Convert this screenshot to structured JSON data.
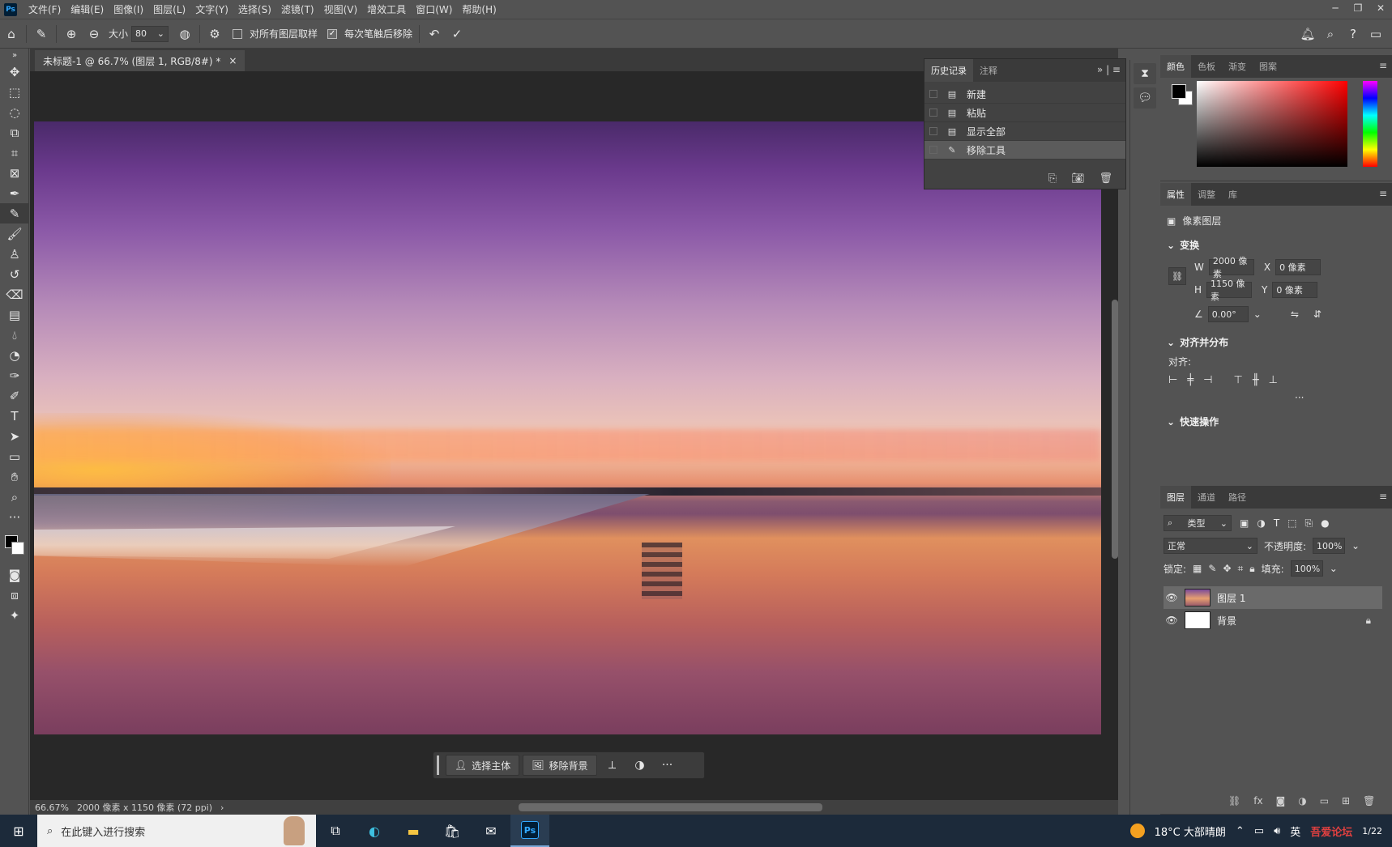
{
  "app": {
    "logo": "Ps"
  },
  "menu": [
    "文件(F)",
    "编辑(E)",
    "图像(I)",
    "图层(L)",
    "文字(Y)",
    "选择(S)",
    "滤镜(T)",
    "视图(V)",
    "增效工具",
    "窗口(W)",
    "帮助(H)"
  ],
  "window_controls": {
    "minimize": "─",
    "restore": "❐",
    "close": "✕"
  },
  "options": {
    "size_label": "大小",
    "size_value": "80",
    "sample_all_label": "对所有图层取样",
    "sample_all_checked": false,
    "remove_after_label": "每次笔触后移除",
    "remove_after_checked": true
  },
  "document": {
    "tab_title": "未标题-1 @ 66.7% (图层 1, RGB/8#) *",
    "close": "×"
  },
  "context_bar": {
    "select_subject": "选择主体",
    "remove_bg": "移除背景",
    "more": "···"
  },
  "history": {
    "tabs": [
      "历史记录",
      "注释"
    ],
    "items": [
      {
        "label": "新建",
        "icon": "document-icon"
      },
      {
        "label": "粘贴",
        "icon": "document-icon"
      },
      {
        "label": "显示全部",
        "icon": "document-icon"
      },
      {
        "label": "移除工具",
        "icon": "remove-tool-icon",
        "active": true
      }
    ]
  },
  "color_panel": {
    "tabs": [
      "颜色",
      "色板",
      "渐变",
      "图案"
    ],
    "foreground": "#000000",
    "background": "#ffffff",
    "hue": "#ff0000"
  },
  "properties": {
    "tabs": [
      "属性",
      "调整",
      "库"
    ],
    "layer_type": "像素图层",
    "transform_title": "变换",
    "w_label": "W",
    "w_value": "2000 像素",
    "h_label": "H",
    "h_value": "1150 像素",
    "x_label": "X",
    "x_value": "0 像素",
    "y_label": "Y",
    "y_value": "0 像素",
    "angle_value": "0.00°",
    "align_title": "对齐并分布",
    "align_label": "对齐:",
    "quick_actions_title": "快速操作",
    "more": "···"
  },
  "layers": {
    "tabs": [
      "图层",
      "通道",
      "路径"
    ],
    "filter_label": "类型",
    "blend_mode": "正常",
    "opacity_label": "不透明度:",
    "opacity_value": "100%",
    "lock_label": "锁定:",
    "fill_label": "填充:",
    "fill_value": "100%",
    "items": [
      {
        "name": "图层 1",
        "active": true
      },
      {
        "name": "背景",
        "locked": true
      }
    ]
  },
  "status": {
    "zoom": "66.67%",
    "doc_info": "2000 像素 x 1150 像素 (72 ppi)"
  },
  "taskbar": {
    "search_placeholder": "在此键入进行搜索",
    "weather": "18°C 大部晴朗",
    "ime": "英",
    "watermark": "吾爱论坛",
    "date_partial": "1/22"
  }
}
